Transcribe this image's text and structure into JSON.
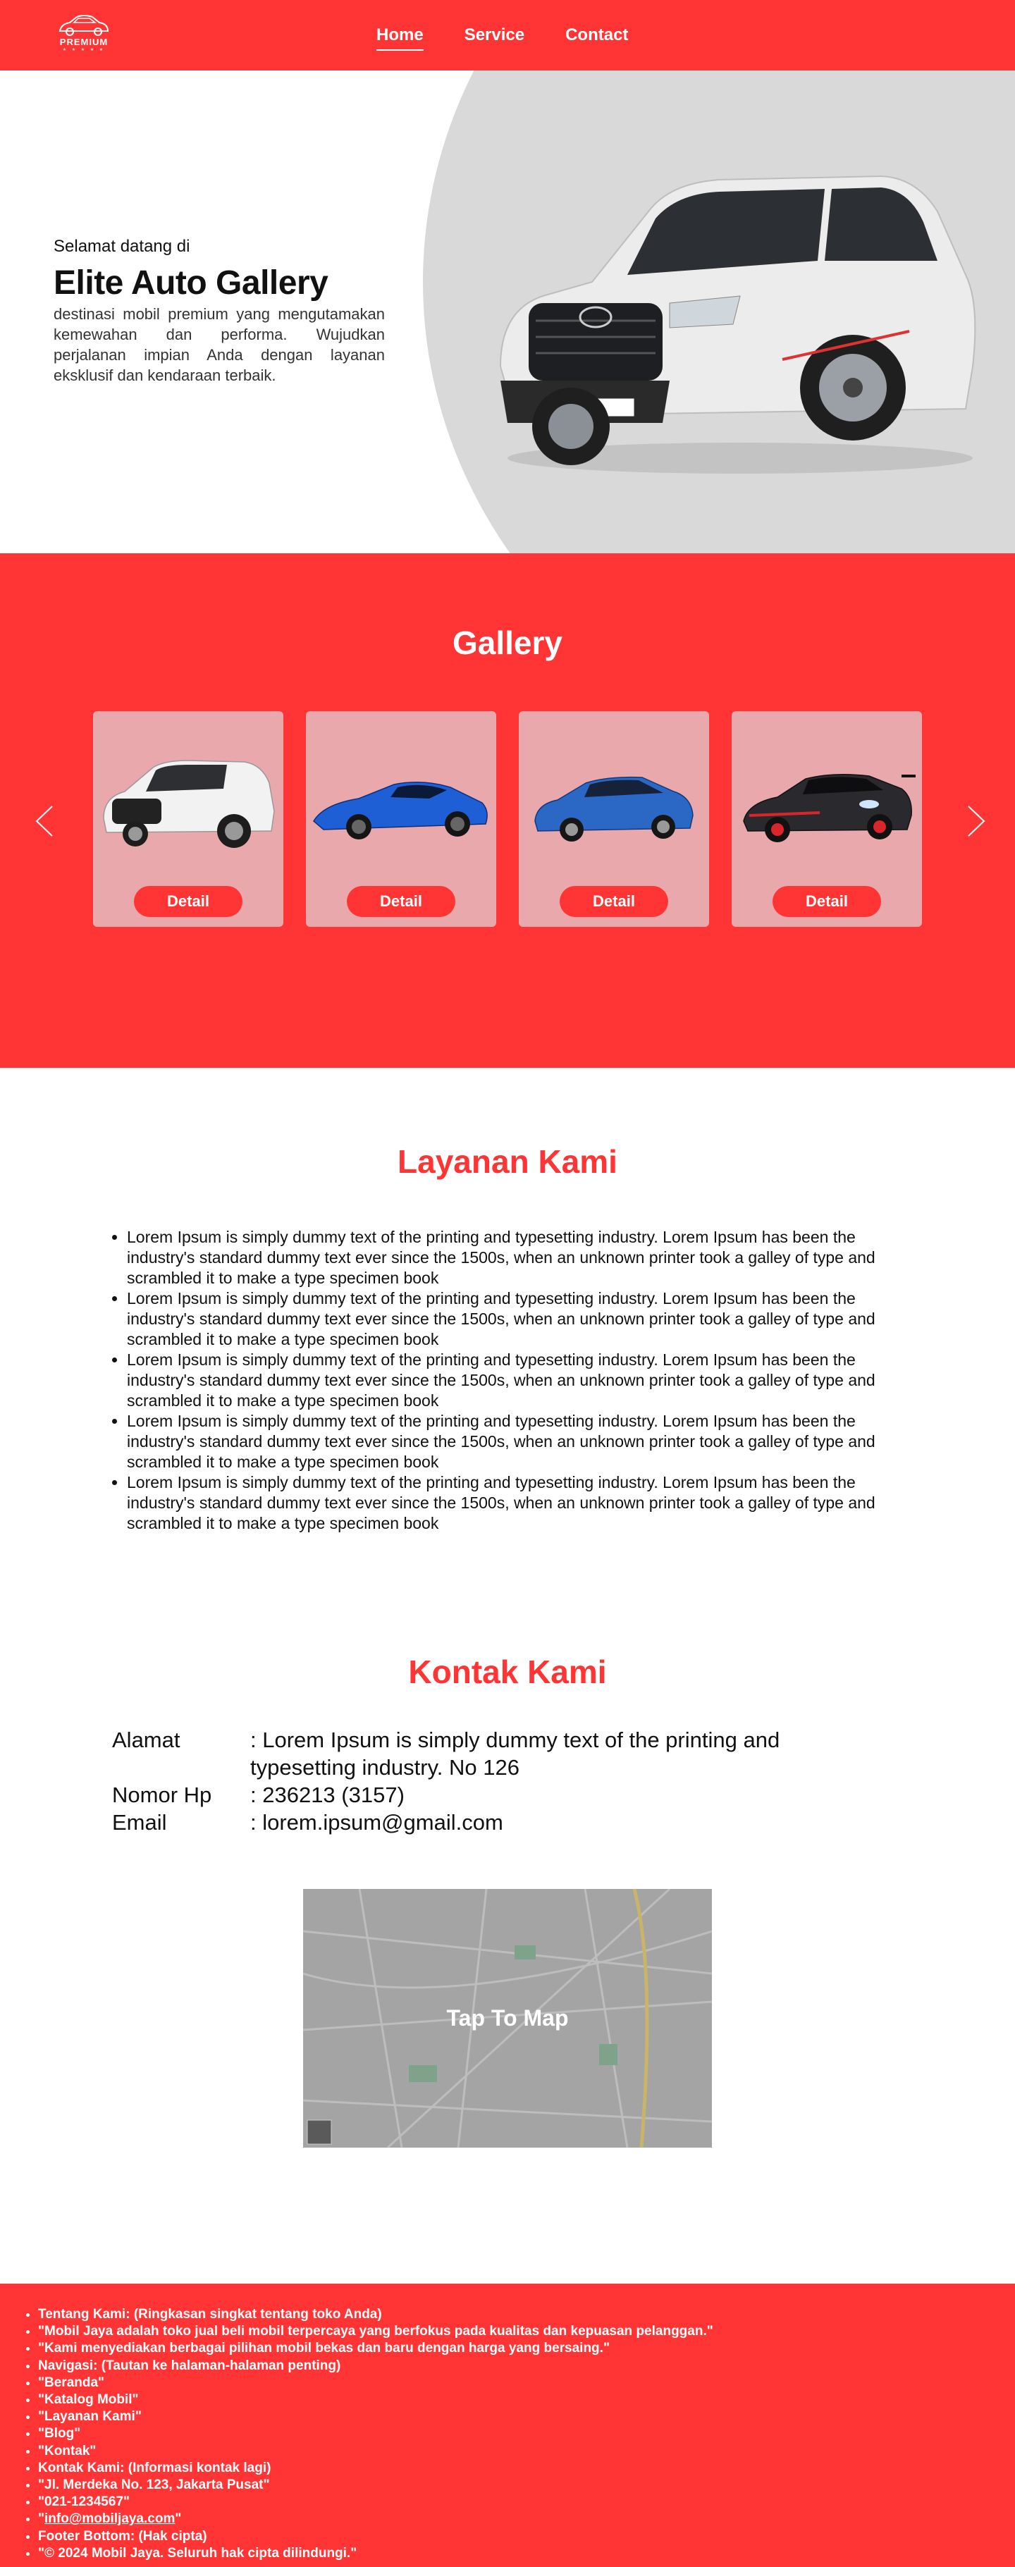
{
  "nav": {
    "logo_text": "PREMIUM",
    "links": [
      {
        "label": "Home",
        "active": true
      },
      {
        "label": "Service",
        "active": false
      },
      {
        "label": "Contact",
        "active": false
      }
    ]
  },
  "hero": {
    "welcome": "Selamat datang di",
    "title": "Elite Auto Gallery",
    "description": "destinasi mobil premium yang mengutamakan kemewahan dan performa. Wujudkan perjalanan impian Anda dengan layanan eksklusif dan kendaraan terbaik."
  },
  "gallery": {
    "title": "Gallery",
    "cards": [
      {
        "button_label": "Detail",
        "car_color": "#f2f2f2"
      },
      {
        "button_label": "Detail",
        "car_color": "#1f5fd6"
      },
      {
        "button_label": "Detail",
        "car_color": "#2b67c4"
      },
      {
        "button_label": "Detail",
        "car_color": "#2a2a2e"
      }
    ]
  },
  "layanan": {
    "title": "Layanan Kami",
    "items": [
      "Lorem Ipsum is simply dummy text of the printing and typesetting industry. Lorem Ipsum has been the industry's standard dummy text ever since the 1500s, when an unknown printer took a galley of type and scrambled it to make a type specimen book",
      "Lorem Ipsum is simply dummy text of the printing and typesetting industry. Lorem Ipsum has been the industry's standard dummy text ever since the 1500s, when an unknown printer took a galley of type and scrambled it to make a type specimen book",
      "Lorem Ipsum is simply dummy text of the printing and typesetting industry. Lorem Ipsum has been the industry's standard dummy text ever since the 1500s, when an unknown printer took a galley of type and scrambled it to make a type specimen book",
      "Lorem Ipsum is simply dummy text of the printing and typesetting industry. Lorem Ipsum has been the industry's standard dummy text ever since the 1500s, when an unknown printer took a galley of type and scrambled it to make a type specimen book",
      "Lorem Ipsum is simply dummy text of the printing and typesetting industry. Lorem Ipsum has been the industry's standard dummy text ever since the 1500s, when an unknown printer took a galley of type and scrambled it to make a type specimen book"
    ]
  },
  "kontak": {
    "title": "Kontak Kami",
    "rows": [
      {
        "label": "Alamat",
        "value": ": Lorem Ipsum is simply dummy text of the printing and typesetting industry. No 126"
      },
      {
        "label": "Nomor Hp",
        "value": ": 236213 (3157)"
      },
      {
        "label": "Email",
        "value": ": lorem.ipsum@gmail.com"
      }
    ],
    "map_label": "Tap To Map"
  },
  "footer": {
    "items": [
      "Tentang Kami: (Ringkasan singkat tentang toko Anda)",
      "\"Mobil Jaya adalah toko jual beli mobil terpercaya yang berfokus pada kualitas dan kepuasan pelanggan.\"",
      "\"Kami menyediakan berbagai pilihan mobil bekas dan baru dengan harga yang bersaing.\"",
      "Navigasi: (Tautan ke halaman-halaman penting)",
      "\"Beranda\"",
      "\"Katalog Mobil\"",
      "\"Layanan Kami\"",
      "\"Blog\"",
      "\"Kontak\"",
      "Kontak Kami: (Informasi kontak lagi)",
      "\"Jl. Merdeka No. 123, Jakarta Pusat\"",
      "\"021-1234567\""
    ],
    "email_link": "info@mobiljaya.com",
    "items_after": [
      "Footer Bottom: (Hak cipta)",
      "\"© 2024 Mobil Jaya. Seluruh hak cipta dilindungi.\""
    ]
  },
  "colors": {
    "brand_red": "#ff3535",
    "card_bg": "#e9a8ab",
    "hero_gray": "#d9d9d9"
  }
}
